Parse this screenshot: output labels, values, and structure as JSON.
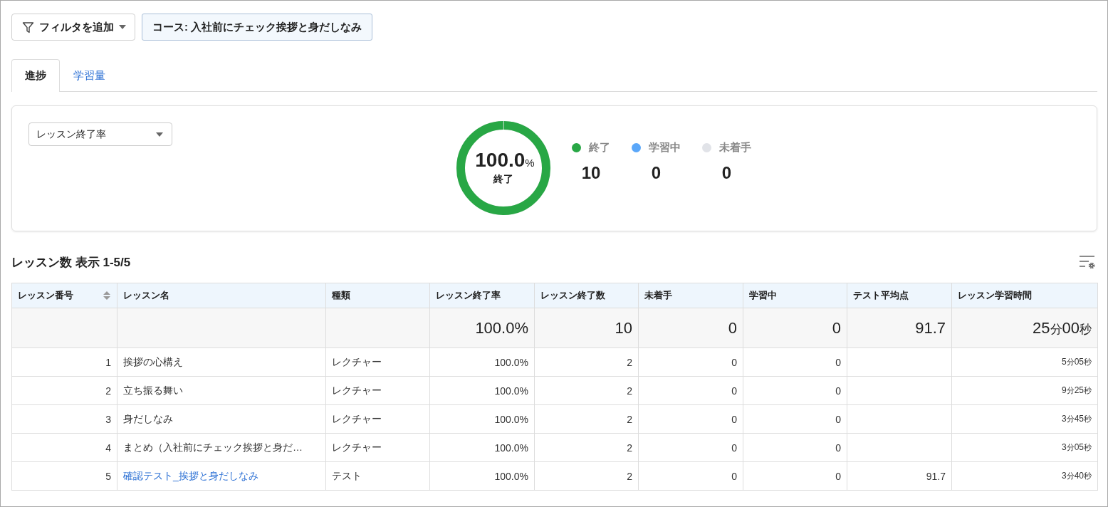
{
  "filters": {
    "add_button": "フィルタを追加",
    "chips": [
      "コース: 入社前にチェック挨拶と身だしなみ"
    ]
  },
  "tabs": [
    {
      "label": "進捗",
      "selected": true
    },
    {
      "label": "学習量",
      "selected": false
    }
  ],
  "progress_card": {
    "metric_select": {
      "value": "レッスン終了率"
    },
    "ring": {
      "level": 1,
      "value": "100.0",
      "unit": "%",
      "label": "終了"
    },
    "legend": [
      {
        "label": "終了",
        "color": "#28a745",
        "count": "10"
      },
      {
        "label": "学習中",
        "color": "#5aa7f9",
        "count": "0"
      },
      {
        "label": "未着手",
        "color": "#e1e3e8",
        "count": "0"
      }
    ]
  },
  "table": {
    "title": "レッスン数 表示 1-5/5",
    "columns": [
      {
        "label": "レッスン番号",
        "sortable": true
      },
      {
        "label": "レッスン名",
        "sortable": false
      },
      {
        "label": "種類",
        "sortable": false
      },
      {
        "label": "レッスン終了率",
        "sortable": false
      },
      {
        "label": "レッスン終了数",
        "sortable": false
      },
      {
        "label": "未着手",
        "sortable": false
      },
      {
        "label": "学習中",
        "sortable": false
      },
      {
        "label": "テスト平均点",
        "sortable": false
      },
      {
        "label": "レッスン学習時間",
        "sortable": false
      }
    ],
    "summary": {
      "completion_rate": "100.0%",
      "completed": "10",
      "not_started": "0",
      "in_progress": "0",
      "test_average": "91.7",
      "study_time": "25分00秒"
    },
    "rows": [
      {
        "number": "1",
        "name": "挨拶の心構え",
        "type": "レクチャー",
        "completion_rate": "100.0%",
        "completed": "2",
        "not_started": "0",
        "in_progress": "0",
        "study_time": "5分05秒",
        "link": false
      },
      {
        "number": "2",
        "name": "立ち振る舞い",
        "type": "レクチャー",
        "completion_rate": "100.0%",
        "completed": "2",
        "not_started": "0",
        "in_progress": "0",
        "study_time": "9分25秒",
        "link": false
      },
      {
        "number": "3",
        "name": "身だしなみ",
        "type": "レクチャー",
        "completion_rate": "100.0%",
        "completed": "2",
        "not_started": "0",
        "in_progress": "0",
        "study_time": "3分45秒",
        "link": false
      },
      {
        "number": "4",
        "name": "まとめ（入社前にチェック挨拶と身だ…",
        "type": "レクチャー",
        "completion_rate": "100.0%",
        "completed": "2",
        "not_started": "0",
        "in_progress": "0",
        "study_time": "3分05秒",
        "link": false
      },
      {
        "number": "5",
        "name": "確認テスト_挨拶と身だしなみ",
        "type": "テスト",
        "completion_rate": "100.0%",
        "completed": "2",
        "not_started": "0",
        "in_progress": "0",
        "test_average": "91.7",
        "study_time": "3分40秒",
        "link": true
      }
    ]
  }
}
